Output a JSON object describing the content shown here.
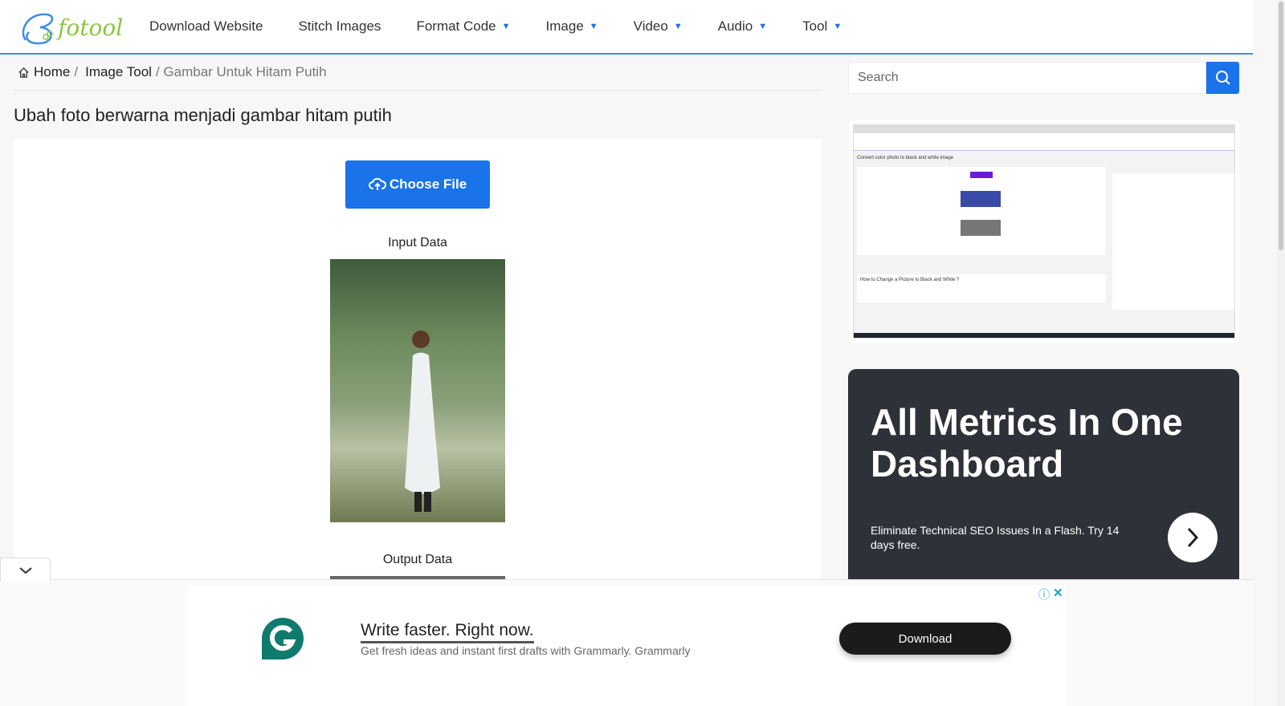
{
  "nav": {
    "logo_text": "fotool",
    "items": [
      {
        "label": "Download Website",
        "dropdown": false
      },
      {
        "label": "Stitch Images",
        "dropdown": false
      },
      {
        "label": "Format Code",
        "dropdown": true
      },
      {
        "label": "Image",
        "dropdown": true
      },
      {
        "label": "Video",
        "dropdown": true
      },
      {
        "label": "Audio",
        "dropdown": true
      },
      {
        "label": "Tool",
        "dropdown": true
      }
    ]
  },
  "breadcrumb": {
    "home": "Home",
    "sep": "/",
    "tool": "Image Tool",
    "current": "/ Gambar Untuk Hitam Putih"
  },
  "page_title": "Ubah foto berwarna menjadi gambar hitam putih",
  "tool": {
    "choose_file": "Choose File",
    "input_label": "Input Data",
    "output_label": "Output Data"
  },
  "search": {
    "placeholder": "Search"
  },
  "preview": {
    "title": "Convert color photo to black and white image",
    "howto": "How to Change a Picture to Black and White ?"
  },
  "ad_side": {
    "title": "All Metrics In One Dashboard",
    "subtitle": "Eliminate Technical SEO Issues In a Flash. Try 14 days free."
  },
  "ad_bottom": {
    "title": "Write faster. Right now.",
    "subtitle": "Get fresh ideas and instant first drafts with Grammarly. Grammarly",
    "button": "Download"
  },
  "colors": {
    "accent": "#1a73e8",
    "logo_green": "#8cc63f",
    "grammarly": "#0f7b6c",
    "ad_dark": "#2e3238"
  }
}
